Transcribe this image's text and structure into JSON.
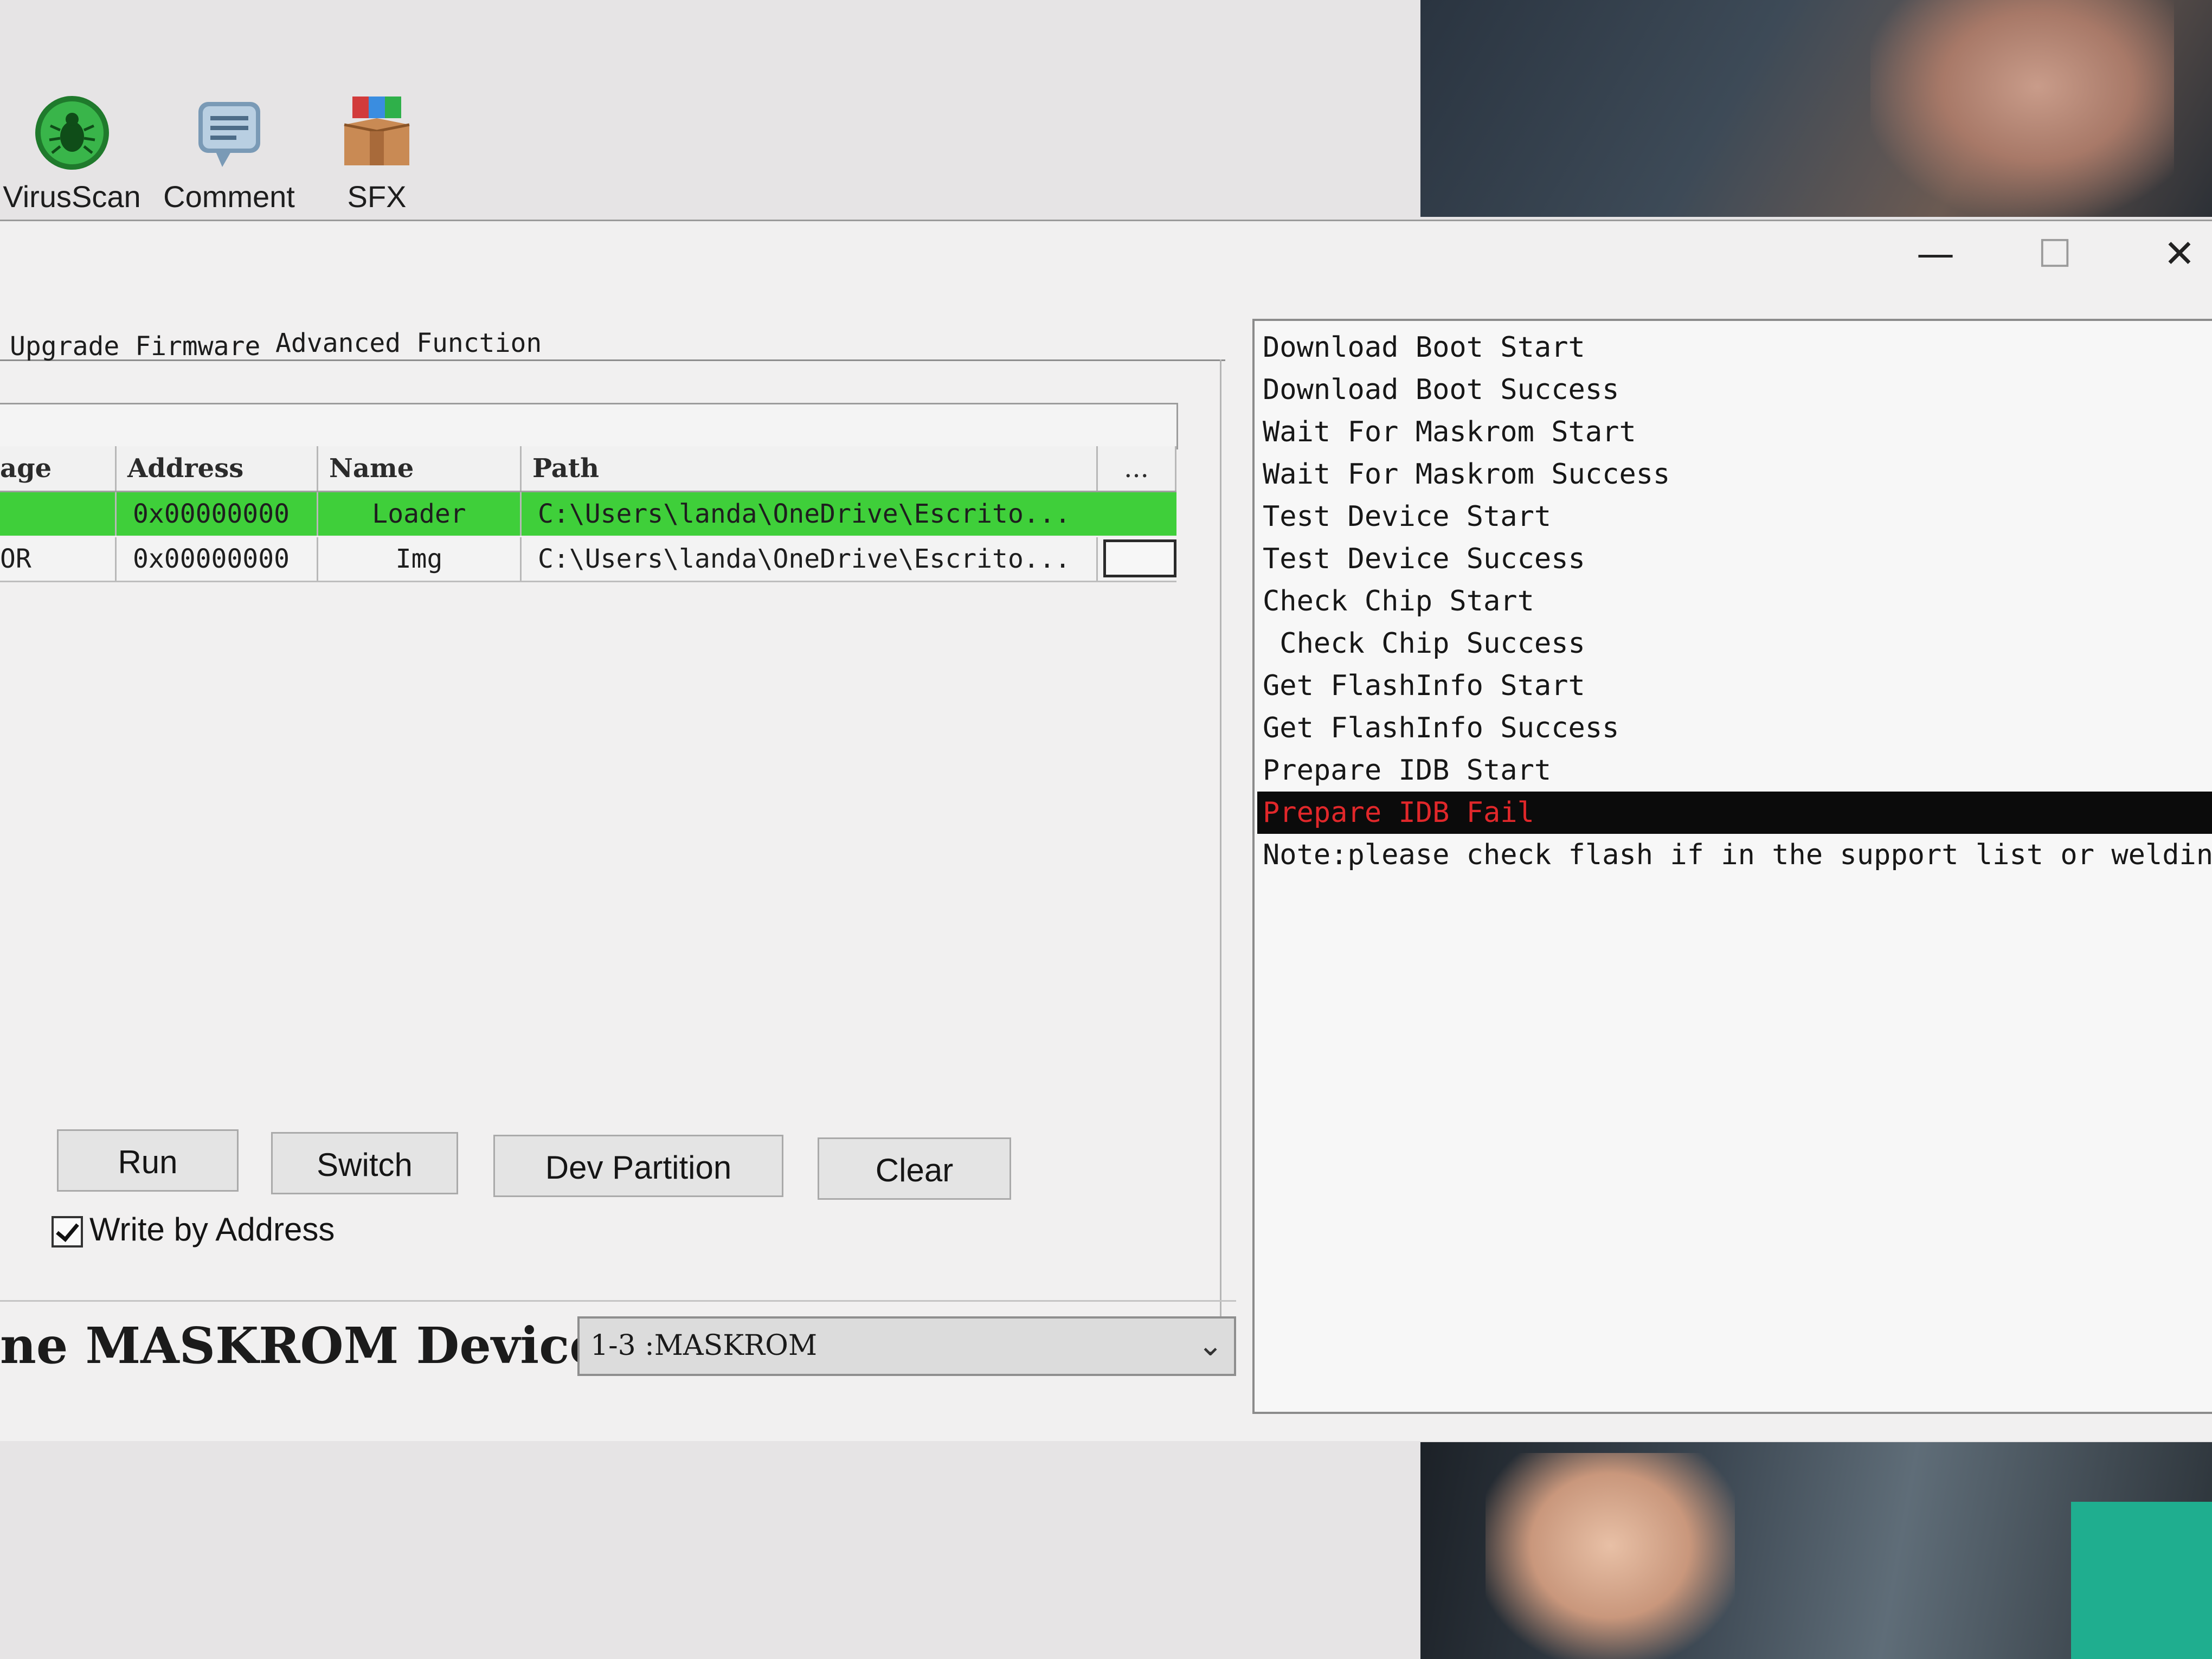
{
  "toolbar": {
    "items": [
      {
        "label": "VirusScan",
        "icon": "bug-shield-icon"
      },
      {
        "label": "Comment",
        "icon": "comment-icon"
      },
      {
        "label": "SFX",
        "icon": "sfx-package-icon"
      }
    ]
  },
  "window": {
    "controls": {
      "minimize": "—",
      "maximize": "☐",
      "close": "✕"
    }
  },
  "tabs": [
    {
      "label": "Upgrade Firmware"
    },
    {
      "label": "Advanced Function"
    }
  ],
  "grid": {
    "columns": [
      "age",
      "Address",
      "Name",
      "Path",
      "..."
    ],
    "rows": [
      {
        "stage": "",
        "address": "0x00000000",
        "name": "Loader",
        "path": "C:\\Users\\landa\\OneDrive\\Escrito...",
        "selected": true
      },
      {
        "stage": "OR",
        "address": "0x00000000",
        "name": "Img",
        "path": "C:\\Users\\landa\\OneDrive\\Escrito...",
        "selected": false
      }
    ]
  },
  "buttons": {
    "run": "Run",
    "switch": "Switch",
    "dev_partition": "Dev Partition",
    "clear": "Clear"
  },
  "write_by_address": {
    "label": "Write by Address",
    "checked": true
  },
  "device": {
    "status": "ne MASKROM Device",
    "selected": "1-3 :MASKROM"
  },
  "log": [
    {
      "text": "Download Boot Start",
      "error": false
    },
    {
      "text": "Download Boot Success",
      "error": false
    },
    {
      "text": "Wait For Maskrom Start",
      "error": false
    },
    {
      "text": "Wait For Maskrom Success",
      "error": false
    },
    {
      "text": "Test Device Start",
      "error": false
    },
    {
      "text": "Test Device Success",
      "error": false
    },
    {
      "text": "Check Chip Start",
      "error": false
    },
    {
      "text": " Check Chip Success",
      "error": false
    },
    {
      "text": "Get FlashInfo Start",
      "error": false
    },
    {
      "text": "Get FlashInfo Success",
      "error": false
    },
    {
      "text": "Prepare IDB Start",
      "error": false
    },
    {
      "text": "Prepare IDB Fail",
      "error": true
    },
    {
      "text": "Note:please check flash if in the support list or welding",
      "error": false
    }
  ],
  "colors": {
    "selected_row": "#3fcf3a",
    "error_text": "#e0272a",
    "error_bg": "#0b0b0b"
  }
}
